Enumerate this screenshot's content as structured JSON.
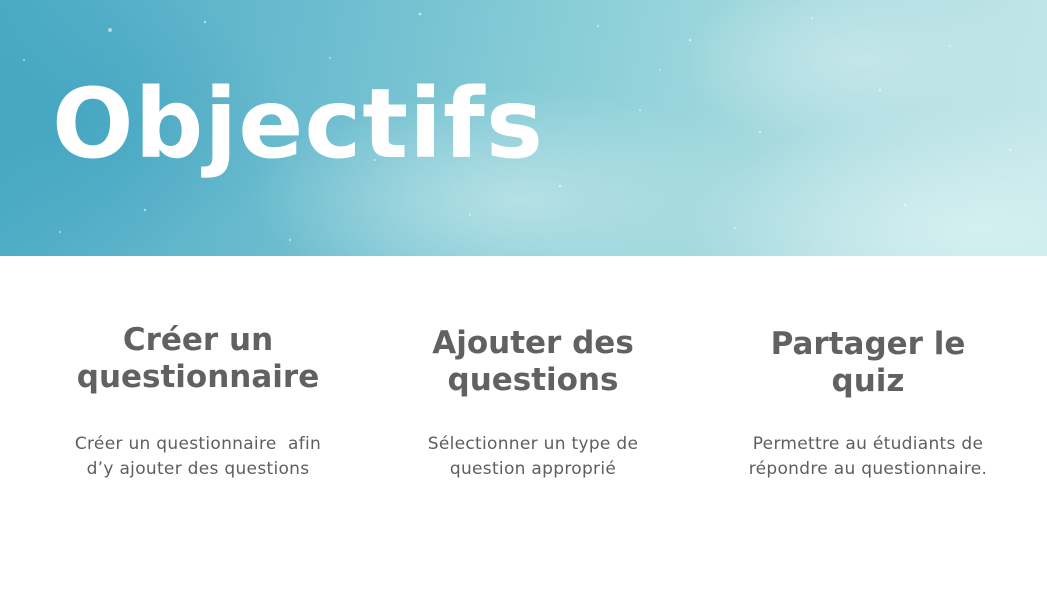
{
  "slide": {
    "title": "Objectifs",
    "columns": [
      {
        "heading_line1": "Créer un",
        "heading_line2": "questionnaire",
        "text_line1": "Créer un questionnaire  afin",
        "text_line2": "d’y ajouter des questions"
      },
      {
        "heading_line1": "Ajouter des",
        "heading_line2": "questions",
        "text_line1": "Sélectionner un type de",
        "text_line2": "question approprié"
      },
      {
        "heading_line1": "Partager le",
        "heading_line2": "quiz",
        "text_line1": "Permettre au étudiants de",
        "text_line2": "répondre au questionnaire."
      }
    ]
  },
  "colors": {
    "title": "#ffffff",
    "heading": "#616161",
    "body_text": "#5e5e5e",
    "banner_left": "#4aaac4",
    "banner_right": "#c4e7ea"
  }
}
